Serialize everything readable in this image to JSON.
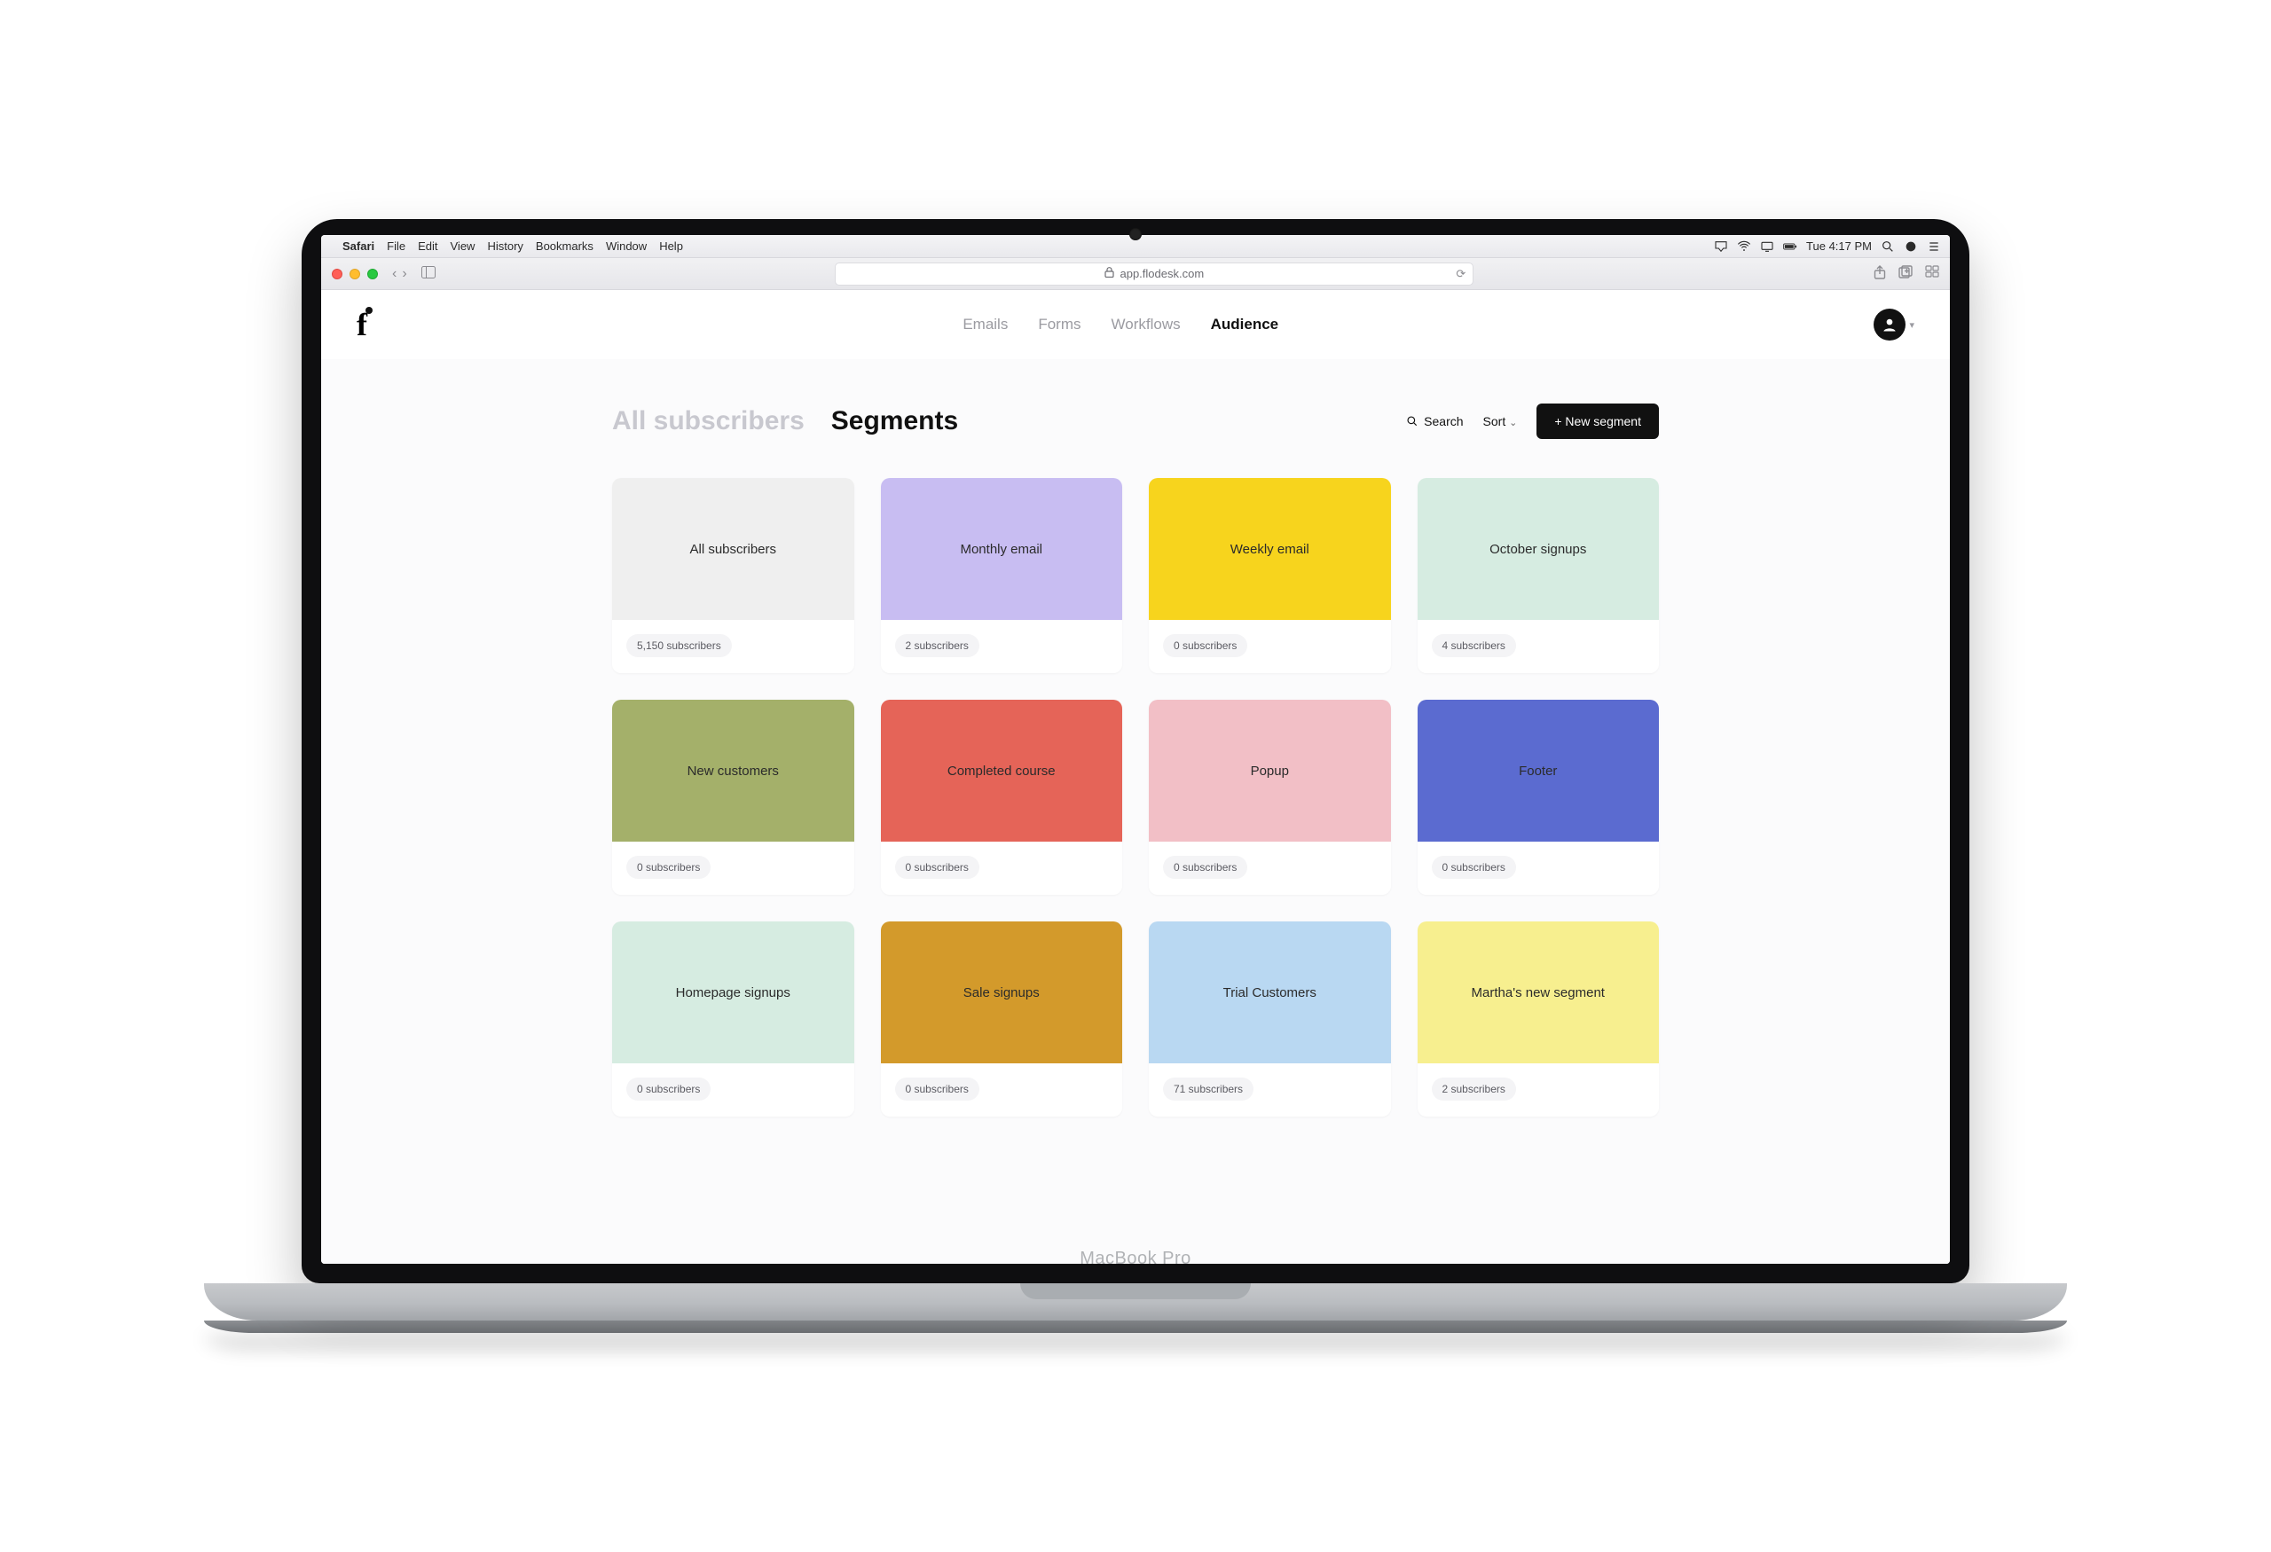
{
  "mac": {
    "app_name": "Safari",
    "menus": [
      "File",
      "Edit",
      "View",
      "History",
      "Bookmarks",
      "Window",
      "Help"
    ],
    "clock": "Tue 4:17 PM"
  },
  "browser": {
    "url": "app.flodesk.com"
  },
  "header": {
    "nav": {
      "emails": "Emails",
      "forms": "Forms",
      "workflows": "Workflows",
      "audience": "Audience"
    }
  },
  "toolbar": {
    "tab_all": "All subscribers",
    "tab_segments": "Segments",
    "search_label": "Search",
    "sort_label": "Sort",
    "new_segment_label": "+ New segment"
  },
  "segments": [
    {
      "name": "All subscribers",
      "count": "5,150 subscribers",
      "color": "#efefef"
    },
    {
      "name": "Monthly email",
      "count": "2 subscribers",
      "color": "#c8bdf2"
    },
    {
      "name": "Weekly email",
      "count": "0 subscribers",
      "color": "#f7d41d"
    },
    {
      "name": "October signups",
      "count": "4 subscribers",
      "color": "#d6ece1"
    },
    {
      "name": "New customers",
      "count": "0 subscribers",
      "color": "#a4b06a"
    },
    {
      "name": "Completed course",
      "count": "0 subscribers",
      "color": "#e56458"
    },
    {
      "name": "Popup",
      "count": "0 subscribers",
      "color": "#f2bfc6"
    },
    {
      "name": "Footer",
      "count": "0 subscribers",
      "color": "#5b6bd0"
    },
    {
      "name": "Homepage signups",
      "count": "0 subscribers",
      "color": "#d6ece1"
    },
    {
      "name": "Sale signups",
      "count": "0 subscribers",
      "color": "#d39a2b"
    },
    {
      "name": "Trial Customers",
      "count": "71 subscribers",
      "color": "#b9d8f2"
    },
    {
      "name": "Martha's new segment",
      "count": "2 subscribers",
      "color": "#f7ef8f"
    }
  ],
  "device_label": "MacBook Pro"
}
